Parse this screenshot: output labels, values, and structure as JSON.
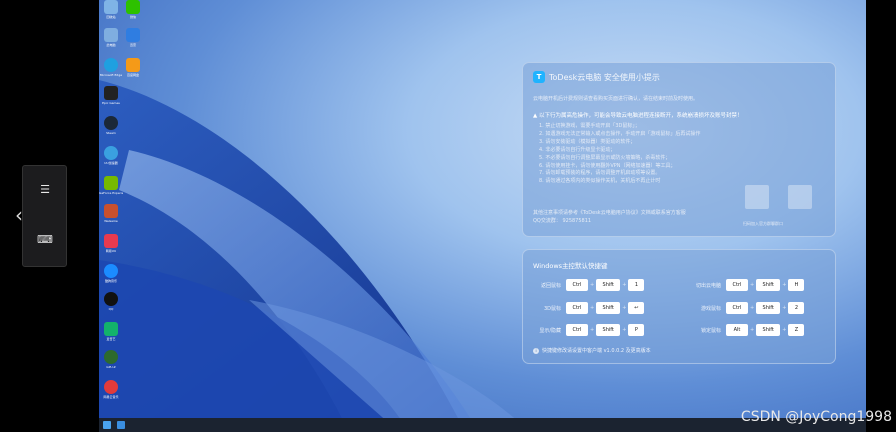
{
  "desktop_icons": [
    {
      "label": "回收站",
      "color": "#7fb3e6"
    },
    {
      "label": "微信",
      "color": "#2dc100"
    },
    {
      "label": "此电脑",
      "color": "#7faee0"
    },
    {
      "label": "迅雷",
      "color": "#2f7de1"
    },
    {
      "label": "Microsoft Edge",
      "color": "#1fa0e0"
    },
    {
      "label": "百度网盘",
      "color": "#f59a18"
    },
    {
      "label": "Epic Games",
      "color": "#222222"
    },
    {
      "label": "Steam",
      "color": "#1b2838"
    },
    {
      "label": "UU加速器",
      "color": "#3aa0e0"
    },
    {
      "label": "GeForce Experience",
      "color": "#76b900"
    },
    {
      "label": "WeGame",
      "color": "#c8502e"
    },
    {
      "label": "网易UU",
      "color": "#e83a4f"
    },
    {
      "label": "酷狗音乐",
      "color": "#1b8cff"
    },
    {
      "label": "QQ",
      "color": "#111111"
    },
    {
      "label": "爱奇艺",
      "color": "#13b26b"
    },
    {
      "label": "GPU-Z",
      "color": "#2d6a2d"
    },
    {
      "label": "网易云音乐",
      "color": "#e23b3b"
    }
  ],
  "tip_card": {
    "logo_text": "T",
    "title": "ToDesk云电脑   安全使用小提示",
    "intro": "云电脑开机后计费规则请查看购买页面进行确认，请在结束时前及时使用。",
    "warning": "以下行为属高危操作，可能会导致云电脑进程连接断开，系统崩溃损坏及账号封禁！",
    "rules": [
      "1. 禁止切换游戏，需要手动开启「3D鼠标」；",
      "2. 如遇游戏无法正常输入或点击操作，手动开启「游戏鼠标」后再试操作",
      "3. 请勿安装驱动（模拟器）类驱动的软件；",
      "4. 非必要请勿自行升级显卡驱动；",
      "5. 不必要请勿自行调整屏幕显示或防火墙策略，杀毒软件；",
      "6. 请勿使用挂卡，请勿使用翻外VPN（网络加速器）等工具；",
      "7. 请勿卸载预装的程序，请勿调整开机启动项等设置。",
      "8. 请勿通过各项内的类似操作关机，关机后不再止计时"
    ],
    "more_line1": "其他注意事项请参考《ToDesk云电脑用户协议》文档或联系官方客服",
    "more_line2": "QQ交流群：  925875811",
    "qr_label": "扫码加入官方群聊群口",
    "qr_label2": "扫码加入官方群口"
  },
  "shortcut_card": {
    "title": "Windows主控默认快捷键",
    "shortcuts": [
      {
        "label": "返回鼠标",
        "keys": [
          "Ctrl",
          "Shift",
          "1"
        ]
      },
      {
        "label": "切出云电脑",
        "keys": [
          "Ctrl",
          "Shift",
          "H"
        ]
      },
      {
        "label": "3D鼠标",
        "keys": [
          "Ctrl",
          "Shift",
          "↩"
        ]
      },
      {
        "label": "游戏鼠标",
        "keys": [
          "Ctrl",
          "Shift",
          "2"
        ]
      },
      {
        "label": "显示/隐藏",
        "keys": [
          "Ctrl",
          "Shift",
          "P"
        ]
      },
      {
        "label": "锁定鼠标",
        "keys": [
          "Alt",
          "Shift",
          "Z"
        ]
      }
    ],
    "plus": "+",
    "note": "快捷键修改请设置中客户端 v1.0.0.2 及更高版本",
    "note_icon": "i"
  },
  "side_panel": {
    "chevron": "‹",
    "menu_icon": "☰",
    "keyboard_icon": "⌨"
  },
  "watermark": "CSDN @JoyCong1998"
}
